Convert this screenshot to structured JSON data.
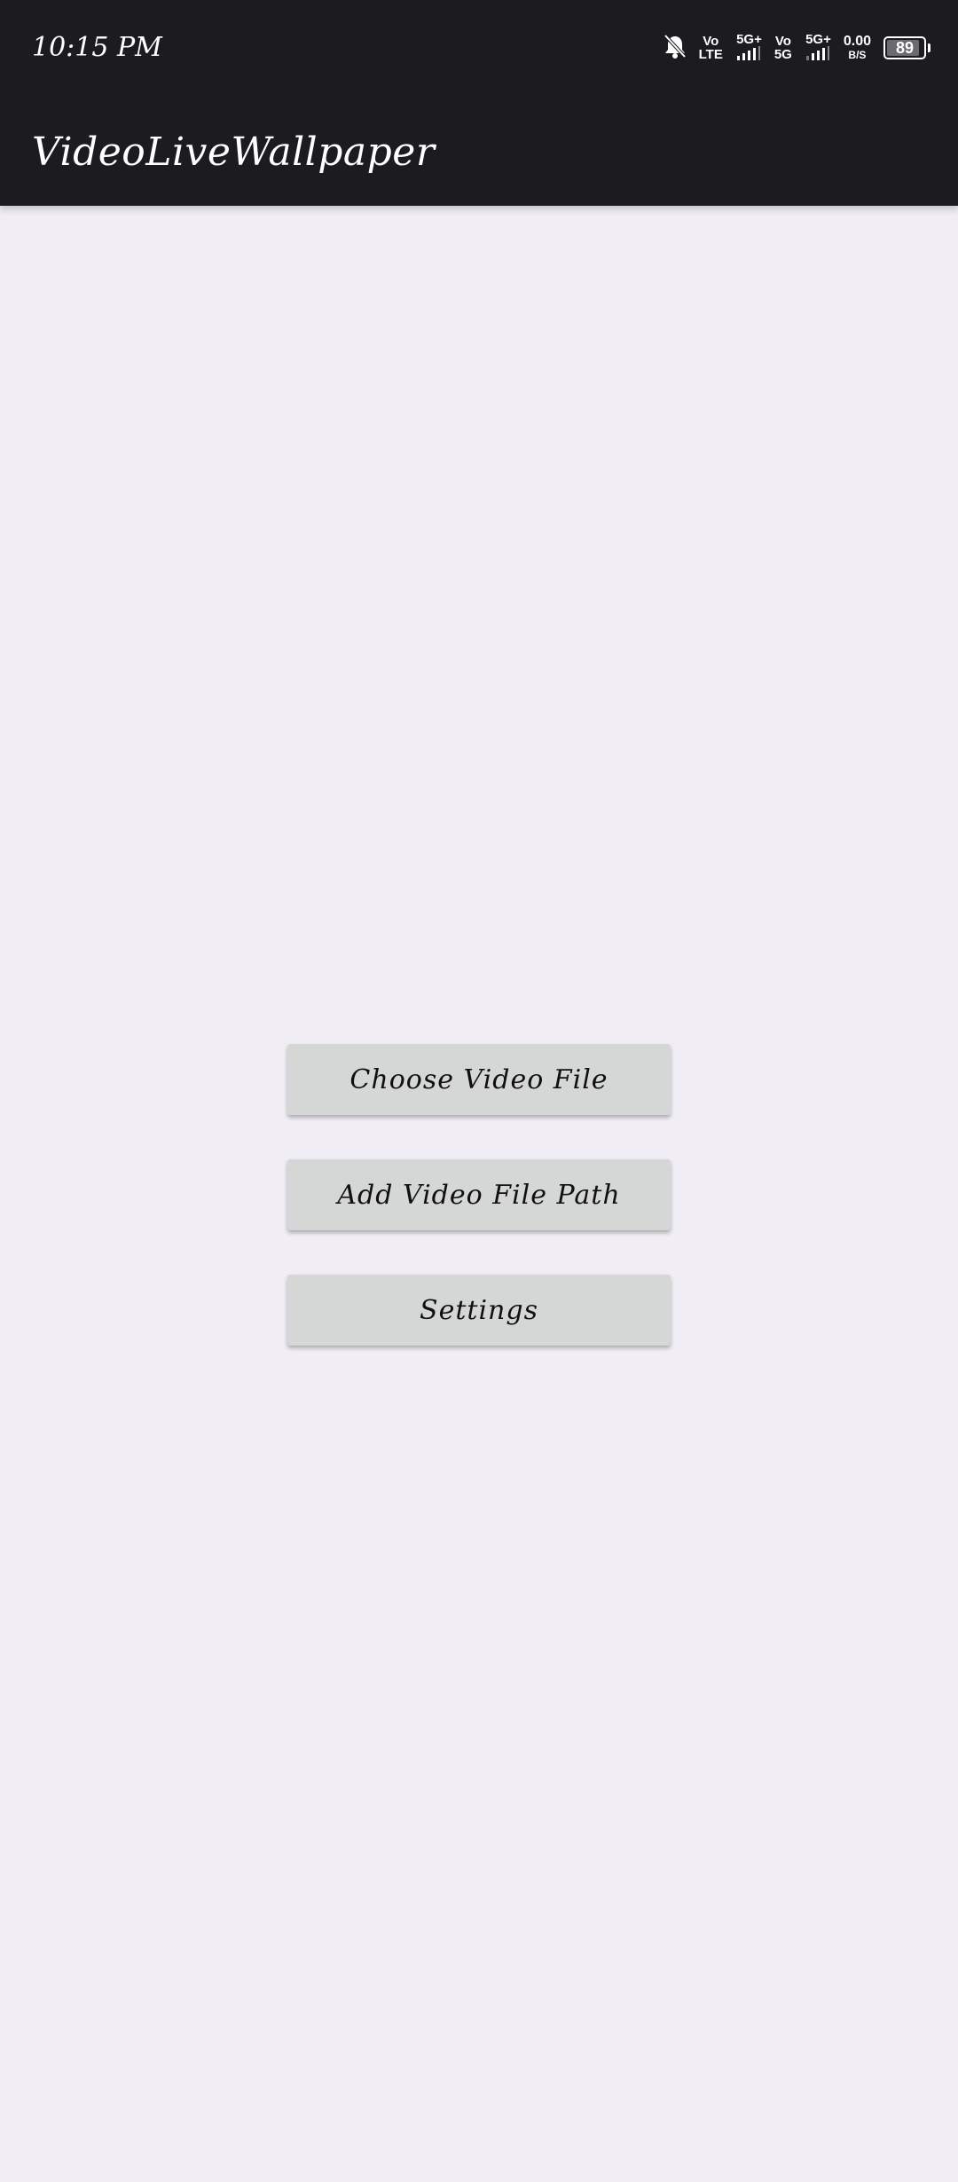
{
  "status_bar": {
    "time": "10:15 PM",
    "icons": [
      "bell-off-icon",
      "signal-icon",
      "signal-icon"
    ],
    "sim1_top": "Vo",
    "sim1_bottom": "LTE",
    "sim1_net": "5G+",
    "sim2_top": "Vo",
    "sim2_bottom": "5G",
    "sim2_net": "5G+",
    "speed_value": "0.00",
    "speed_unit": "B/S",
    "battery_level": "89"
  },
  "app_bar": {
    "title": "VideoLiveWallpaper"
  },
  "actions": {
    "choose_video_label": "Choose Video File",
    "add_path_label": "Add Video File Path",
    "settings_label": "Settings"
  },
  "colors": {
    "app_bar": "#1c1b20",
    "background": "#f0eef4",
    "button": "#d5d7d6"
  }
}
